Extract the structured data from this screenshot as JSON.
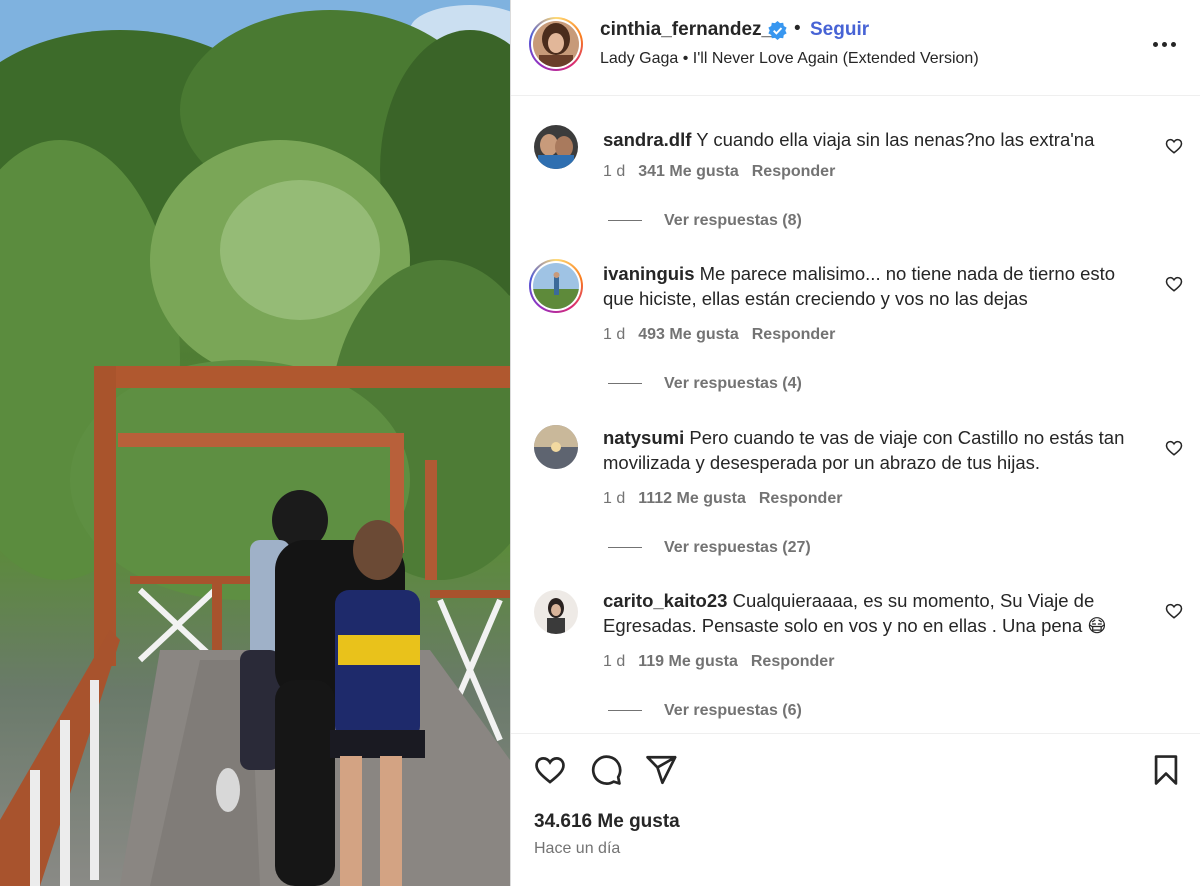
{
  "post": {
    "username": "cinthia_fernandez_",
    "follow_label": "Seguir",
    "separator": "•",
    "audio": "Lady Gaga • I'll Never Love Again (Extended Version)"
  },
  "comments": [
    {
      "username": "sandra.dlf",
      "text": "Y cuando ella viaja sin las nenas?no las extra'na",
      "age": "1 d",
      "likes": "341 Me gusta",
      "reply_label": "Responder",
      "view_replies": "Ver respuestas (8)"
    },
    {
      "username": "ivaninguis",
      "text": "Me parece malisimo... no tiene nada de tierno esto que hiciste, ellas están creciendo y vos no las dejas",
      "age": "1 d",
      "likes": "493 Me gusta",
      "reply_label": "Responder",
      "view_replies": "Ver respuestas (4)"
    },
    {
      "username": "natysumi",
      "text": "Pero cuando te vas de viaje con Castillo no estás tan movilizada y desesperada por un abrazo de tus hijas.",
      "age": "1 d",
      "likes": "1112 Me gusta",
      "reply_label": "Responder",
      "view_replies": "Ver respuestas (27)"
    },
    {
      "username": "carito_kaito23",
      "text": "Cualquieraaaa, es su momento, Su Viaje de Egresadas. Pensaste solo en vos y no en ellas . Una pena 😷",
      "age": "1 d",
      "likes": "119 Me gusta",
      "reply_label": "Responder",
      "view_replies": "Ver respuestas (6)"
    }
  ],
  "footer": {
    "likes": "34.616 Me gusta",
    "time": "Hace un día"
  },
  "icons": {
    "header": [
      "verified-badge-icon",
      "more-options-icon"
    ],
    "actions": [
      "heart-icon",
      "comment-icon",
      "share-icon",
      "bookmark-icon"
    ]
  },
  "colors": {
    "follow": "#4763d5",
    "verified": "#3897f0",
    "muted_text": "#737373",
    "primary_text": "#262626"
  }
}
